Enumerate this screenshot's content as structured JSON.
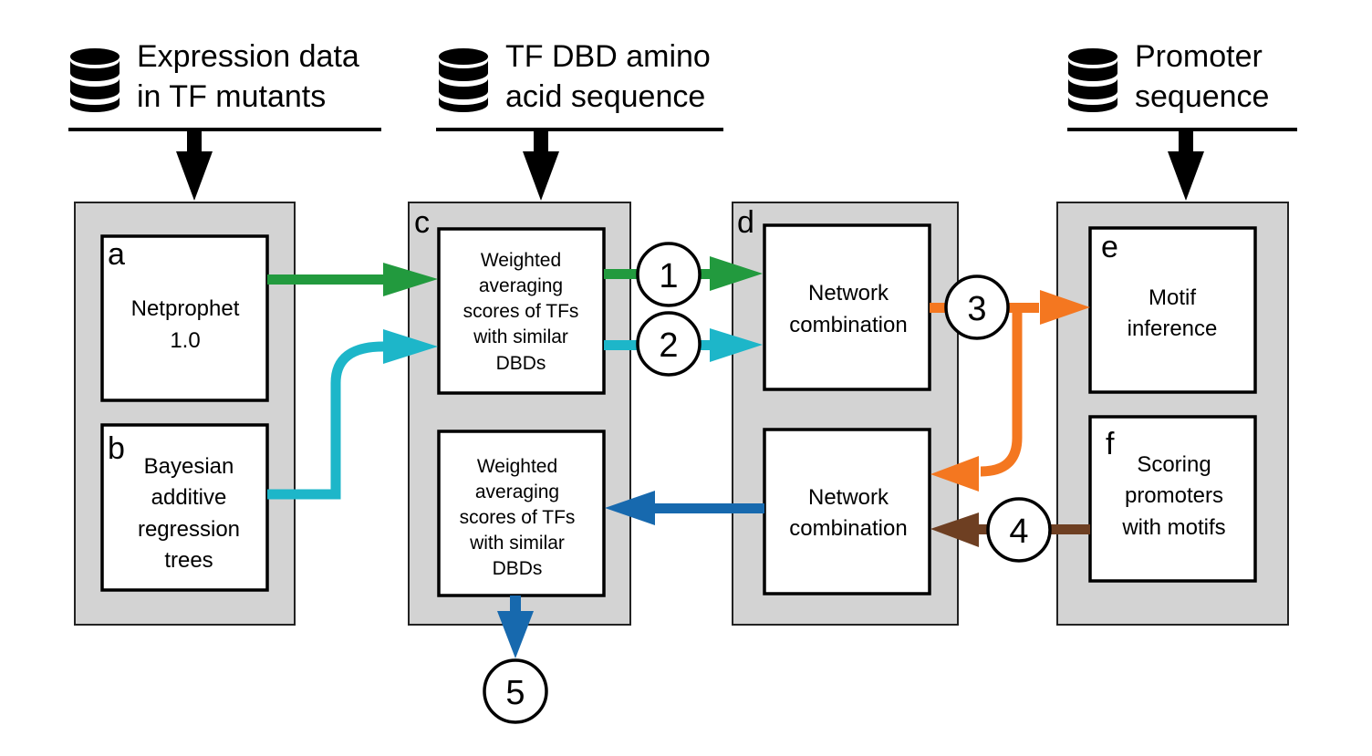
{
  "sources": [
    {
      "icon": "database-icon",
      "lines": [
        "Expression data",
        "in TF mutants"
      ]
    },
    {
      "icon": "database-icon",
      "lines": [
        "TF DBD amino",
        "acid sequence"
      ]
    },
    {
      "icon": "database-icon",
      "lines": [
        "Promoter",
        "sequence"
      ]
    }
  ],
  "boxes": {
    "a": {
      "label": "a",
      "lines": [
        "Netprophet",
        "1.0"
      ]
    },
    "b": {
      "label": "b",
      "lines": [
        "Bayesian",
        "additive",
        "regression",
        "trees"
      ]
    },
    "c": {
      "label": "c",
      "lines": [
        "Weighted",
        "averaging",
        "scores of TFs",
        "with similar",
        "DBDs"
      ]
    },
    "c2": {
      "lines": [
        "Weighted",
        "averaging",
        "scores of TFs",
        "with similar",
        "DBDs"
      ]
    },
    "d": {
      "label": "d",
      "lines": [
        "Network",
        "combination"
      ]
    },
    "d2": {
      "lines": [
        "Network",
        "combination"
      ]
    },
    "e": {
      "label": "e",
      "lines": [
        "Motif",
        "inference"
      ]
    },
    "f": {
      "label": "f",
      "lines": [
        "Scoring",
        "promoters",
        "with motifs"
      ]
    }
  },
  "steps": [
    "1",
    "2",
    "3",
    "4",
    "5"
  ],
  "colors": {
    "green": "#229a3e",
    "cyan": "#1db6c9",
    "orange": "#f47720",
    "brown": "#6e3f22",
    "blue": "#1769ae",
    "panel": "#d3d3d3"
  }
}
